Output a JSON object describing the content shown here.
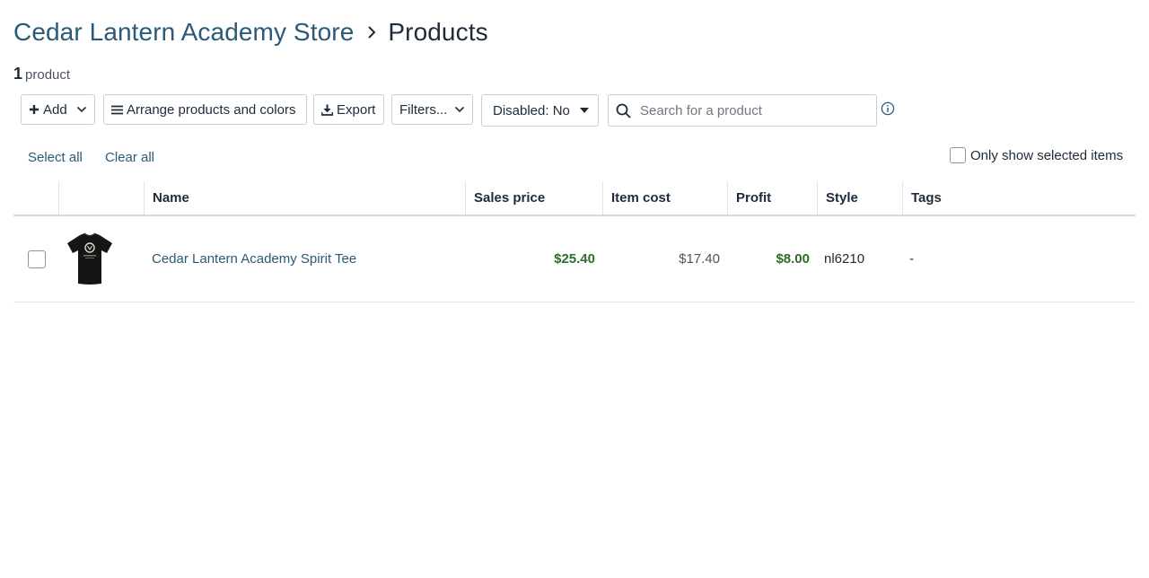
{
  "breadcrumb": {
    "store": "Cedar Lantern Academy Store",
    "current": "Products"
  },
  "count": {
    "number": "1",
    "label": "product"
  },
  "toolbar": {
    "add": "Add",
    "arrange": "Arrange products and colors",
    "export": "Export",
    "filters": "Filters...",
    "disabled": "Disabled: No",
    "search_placeholder": "Search for a product",
    "search_value": ""
  },
  "selection": {
    "select_all": "Select all",
    "clear_all": "Clear all",
    "only_selected": "Only show selected items",
    "only_selected_checked": false
  },
  "table": {
    "columns": {
      "name": "Name",
      "sales_price": "Sales price",
      "item_cost": "Item cost",
      "profit": "Profit",
      "style": "Style",
      "tags": "Tags"
    },
    "rows": [
      {
        "checked": false,
        "name": "Cedar Lantern Academy Spirit Tee",
        "sales_price": "$25.40",
        "item_cost": "$17.40",
        "profit": "$8.00",
        "style": "nl6210",
        "tags": "-"
      }
    ]
  },
  "colors": {
    "link": "#2a5a78",
    "title": "#1d2b3a",
    "money_green": "#2f6b2a",
    "border": "#c9ced3"
  },
  "icons": {
    "chevron": "chevron-right-icon",
    "add": "plus-icon",
    "arrange": "hamburger-menu-icon",
    "export": "download-icon",
    "dropdown": "chevron-down-icon",
    "caret": "caret-down-icon",
    "search": "search-icon",
    "info": "info-icon"
  }
}
